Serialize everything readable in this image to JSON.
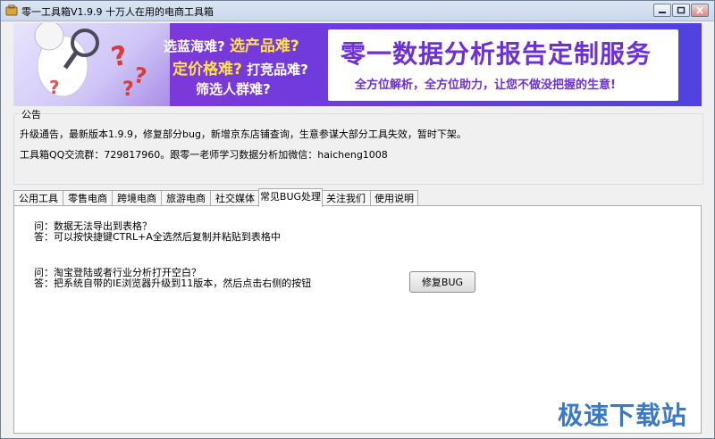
{
  "window": {
    "title": "零一工具箱V1.9.9 十万人在用的电商工具箱"
  },
  "banner": {
    "line1_a": "选蓝海难?",
    "line1_b": "选产品难?",
    "line2_a": "定价格难?",
    "line2_b": "打竞品难?",
    "line3": "筛选人群难?",
    "promo_title": "零一数据分析报告定制服务",
    "promo_subtitle": "全方位解析，全方位助力，让您不做没把握的生意!",
    "question_mark": "?"
  },
  "notice": {
    "legend": "公告",
    "line1": "升级通告，最新版本1.9.9，修复部分bug，新增京东店铺查询，生意参谋大部分工具失效，暂时下架。",
    "line2": "工具箱QQ交流群：729817960。跟零一老师学习数据分析加微信：haicheng1008"
  },
  "tabs": [
    {
      "label": "公用工具"
    },
    {
      "label": "零售电商"
    },
    {
      "label": "跨境电商"
    },
    {
      "label": "旅游电商"
    },
    {
      "label": "社交媒体"
    },
    {
      "label": "常见BUG处理"
    },
    {
      "label": "关注我们"
    },
    {
      "label": "使用说明"
    }
  ],
  "faq": {
    "q1": "问：数据无法导出到表格？",
    "a1": "答：可以按快捷键CTRL+A全选然后复制并粘贴到表格中",
    "q2": "问：淘宝登陆或者行业分析打开空白？",
    "a2": "答：把系统自带的IE浏览器升级到11版本，然后点击右侧的按钮",
    "fix_button": "修复BUG"
  },
  "watermark": "极速下载站",
  "colors": {
    "accent": "#6c2fd8",
    "highlight": "#ffe14a",
    "watermark": "#3a79c6"
  }
}
